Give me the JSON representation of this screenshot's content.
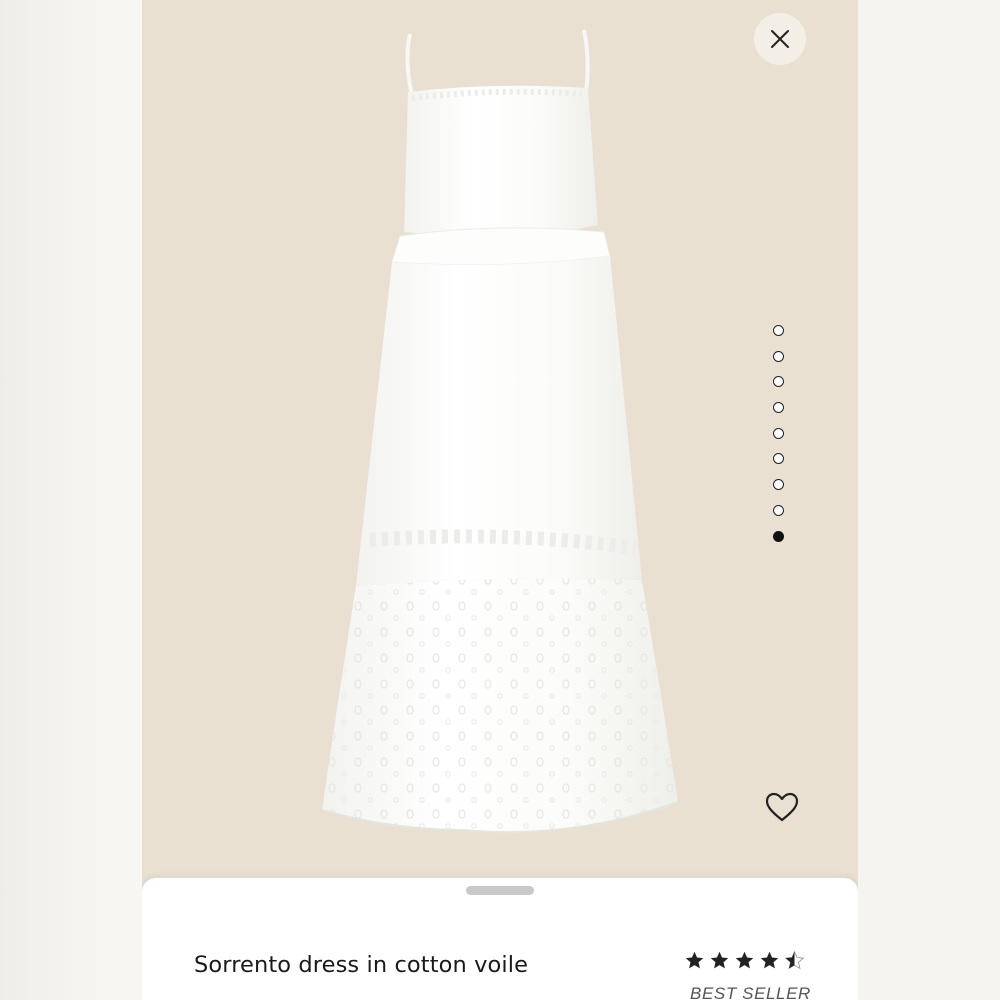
{
  "window": {
    "close_icon": "close-icon"
  },
  "gallery": {
    "image_count": 9,
    "active_index": 8,
    "image_description_icon": "dress-image"
  },
  "favorite": {
    "icon": "heart-outline-icon"
  },
  "product": {
    "title": "Sorrento dress in cotton voile",
    "rating": 4.5,
    "rating_max": 5,
    "badge": "BEST SELLER"
  },
  "colors": {
    "backdrop": "#e9e0d2",
    "sheet": "#ffffff",
    "text": "#1a1a1a",
    "star": "#222222"
  }
}
